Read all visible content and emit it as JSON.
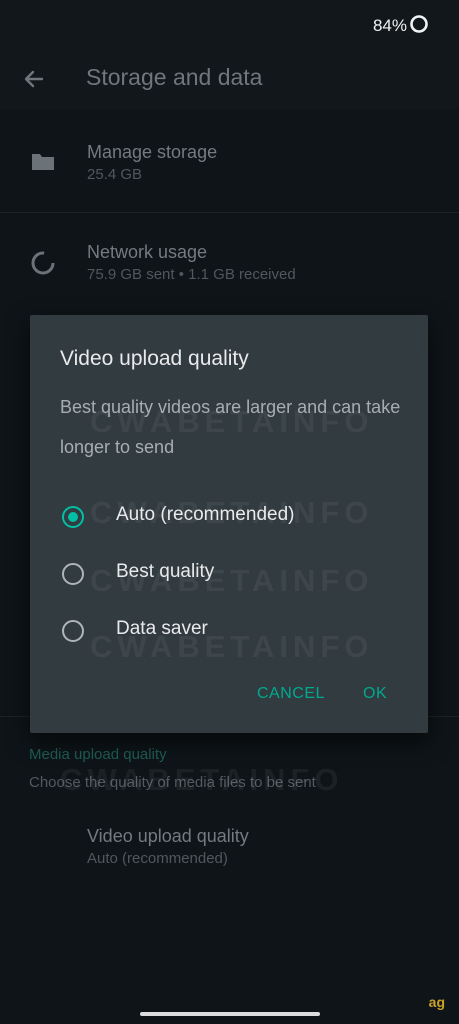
{
  "status_bar": {
    "battery": "84%"
  },
  "app_bar": {
    "title": "Storage and data"
  },
  "list": [
    {
      "title": "Manage storage",
      "subtitle": "25.4 GB",
      "icon": "folder-icon"
    },
    {
      "title": "Network usage",
      "subtitle": "75.9 GB sent • 1.1 GB received",
      "icon": "data-usage-icon"
    }
  ],
  "media_section": {
    "header": "Media upload quality",
    "description": "Choose the quality of media files to be sent",
    "setting_title": "Video upload quality",
    "setting_value": "Auto (recommended)"
  },
  "dialog": {
    "title": "Video upload quality",
    "message": "Best quality videos are larger and can take longer to send",
    "options": [
      {
        "label": "Auto (recommended)",
        "selected": true
      },
      {
        "label": "Best quality",
        "selected": false
      },
      {
        "label": "Data saver",
        "selected": false
      }
    ],
    "cancel_label": "CANCEL",
    "ok_label": "OK"
  },
  "watermark": "CWABETAINFO",
  "corner_logo": "ag",
  "colors": {
    "accent": "#00bfa5",
    "dialog_bg": "#323b40",
    "page_bg": "#0e1418"
  }
}
